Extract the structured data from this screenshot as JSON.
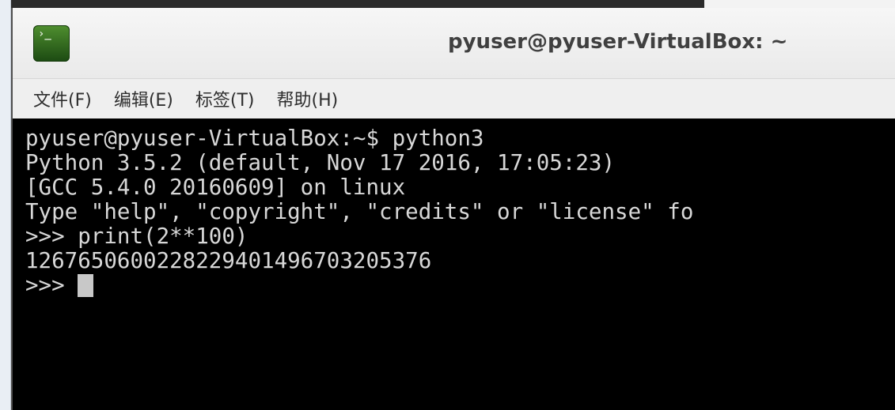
{
  "window": {
    "title": "pyuser@pyuser-VirtualBox: ~",
    "icon": "terminal-icon",
    "icon_glyph": "›_"
  },
  "menubar": {
    "items": [
      {
        "label": "文件(F)"
      },
      {
        "label": "编辑(E)"
      },
      {
        "label": "标签(T)"
      },
      {
        "label": "帮助(H)"
      }
    ]
  },
  "terminal": {
    "lines": [
      "pyuser@pyuser-VirtualBox:~$ python3",
      "Python 3.5.2 (default, Nov 17 2016, 17:05:23)",
      "[GCC 5.4.0 20160609] on linux",
      "Type \"help\", \"copyright\", \"credits\" or \"license\" fo",
      ">>> print(2**100)",
      "1267650600228229401496703205376"
    ],
    "prompt": ">>> "
  },
  "colors": {
    "terminal_bg": "#000000",
    "terminal_fg": "#d8d8d8",
    "titlebar_bg": "#efefef",
    "icon_green": "#3a7a22"
  }
}
